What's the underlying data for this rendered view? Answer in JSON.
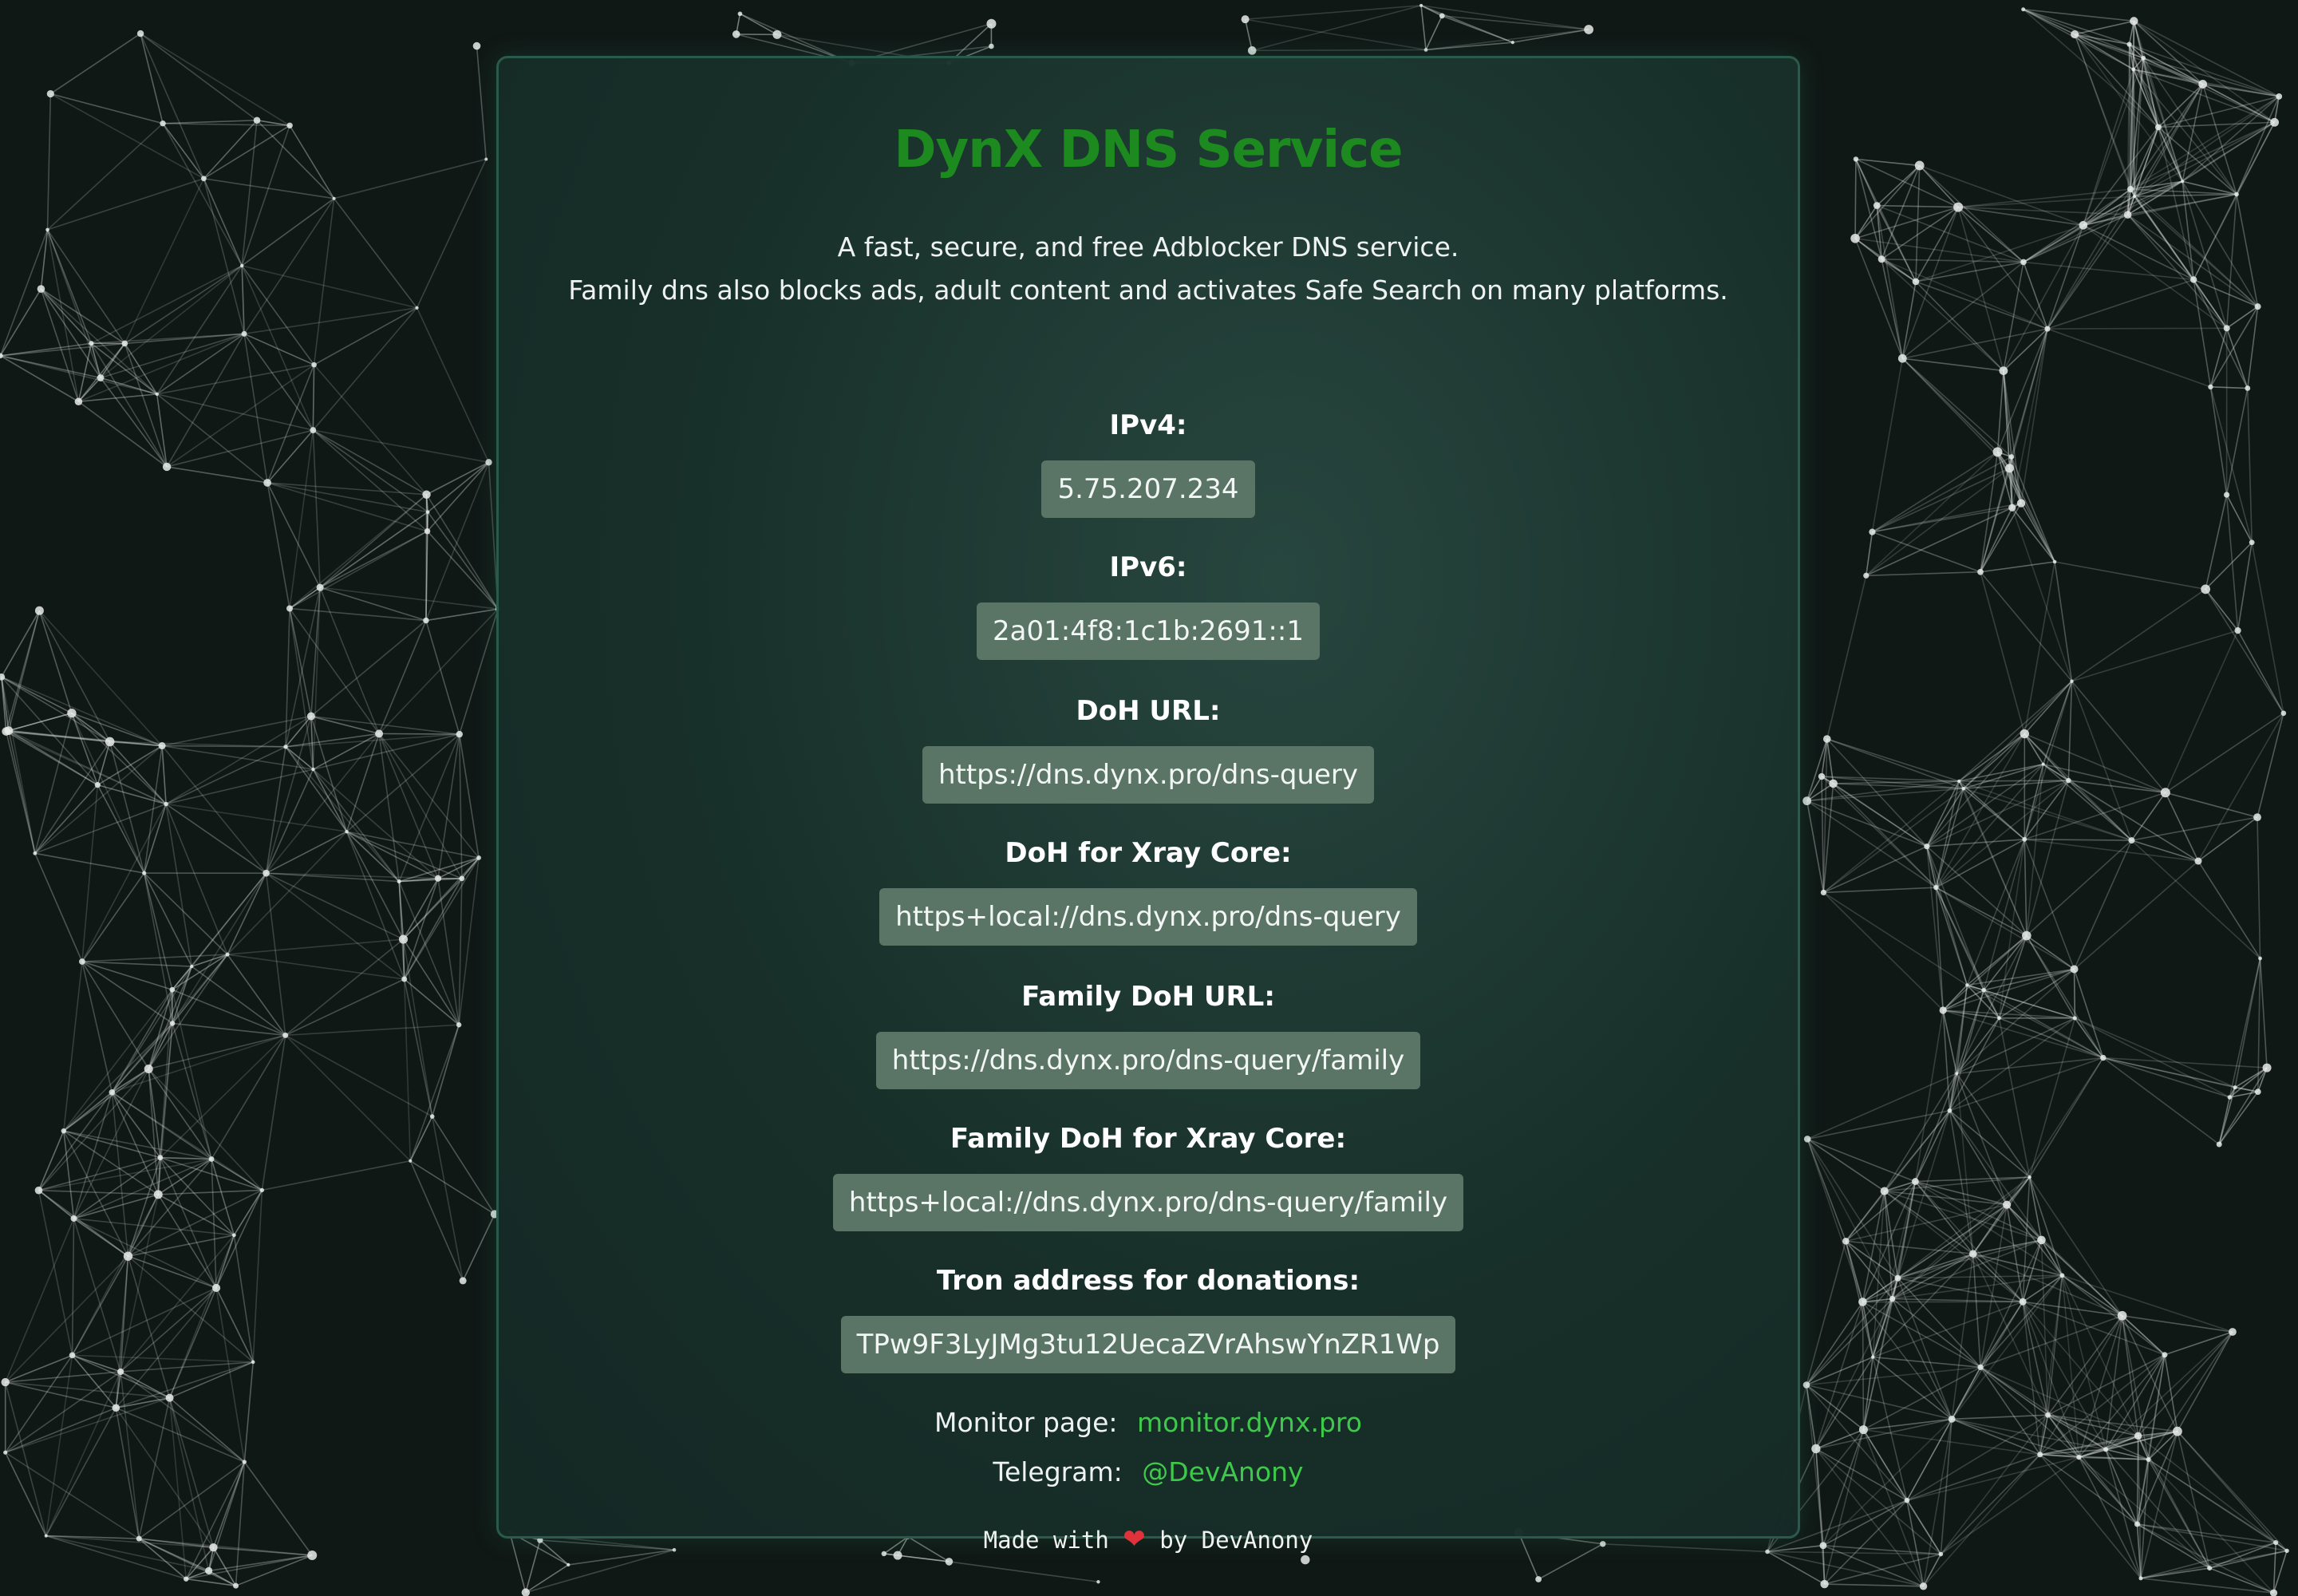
{
  "colors": {
    "background": "#101816",
    "title": "#1c8a1f",
    "link": "#3ec94a",
    "value_box": "#5a7466",
    "card_border": "#2a5a4a"
  },
  "title": "DynX DNS Service",
  "description": {
    "line1": "A fast, secure, and free Adblocker DNS service.",
    "line2": "Family dns also blocks ads, adult content and activates Safe Search on many platforms."
  },
  "entries": [
    {
      "label": "IPv4:",
      "value": "5.75.207.234"
    },
    {
      "label": "IPv6:",
      "value": "2a01:4f8:1c1b:2691::1"
    },
    {
      "label": "DoH URL:",
      "value": "https://dns.dynx.pro/dns-query"
    },
    {
      "label": "DoH for Xray Core:",
      "value": "https+local://dns.dynx.pro/dns-query"
    },
    {
      "label": "Family DoH URL:",
      "value": "https://dns.dynx.pro/dns-query/family"
    },
    {
      "label": "Family DoH for Xray Core:",
      "value": "https+local://dns.dynx.pro/dns-query/family"
    },
    {
      "label": "Tron address for donations:",
      "value": "TPw9F3LyJMg3tu12UecaZVrAhswYnZR1Wp"
    }
  ],
  "links": {
    "monitor_label": "Monitor page:",
    "monitor_text": "monitor.dynx.pro",
    "telegram_label": "Telegram:",
    "telegram_text": "@DevAnony"
  },
  "footer": {
    "prefix": "Made with",
    "heart_icon": "heart-icon",
    "suffix": "by DevAnony"
  }
}
